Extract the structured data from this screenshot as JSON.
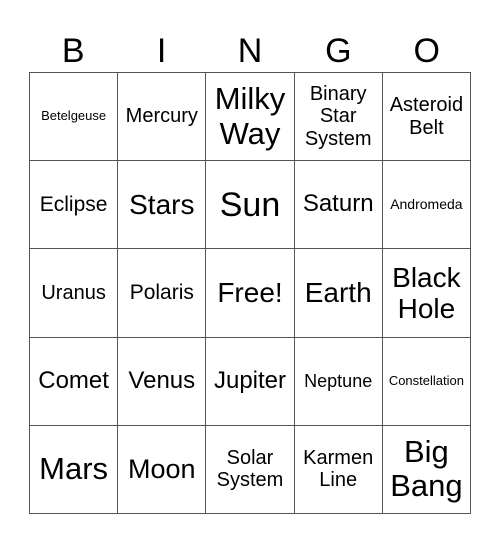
{
  "header": {
    "letters": [
      "B",
      "I",
      "N",
      "G",
      "O"
    ]
  },
  "card": {
    "rows": [
      [
        "Betelgeuse",
        "Mercury",
        "Milky Way",
        "Binary Star System",
        "Asteroid Belt"
      ],
      [
        "Eclipse",
        "Stars",
        "Sun",
        "Saturn",
        "Andromeda"
      ],
      [
        "Uranus",
        "Polaris",
        "Free!",
        "Earth",
        "Black Hole"
      ],
      [
        "Comet",
        "Venus",
        "Jupiter",
        "Neptune",
        "Constellation"
      ],
      [
        "Mars",
        "Moon",
        "Solar System",
        "Karmen Line",
        "Big Bang"
      ]
    ]
  }
}
